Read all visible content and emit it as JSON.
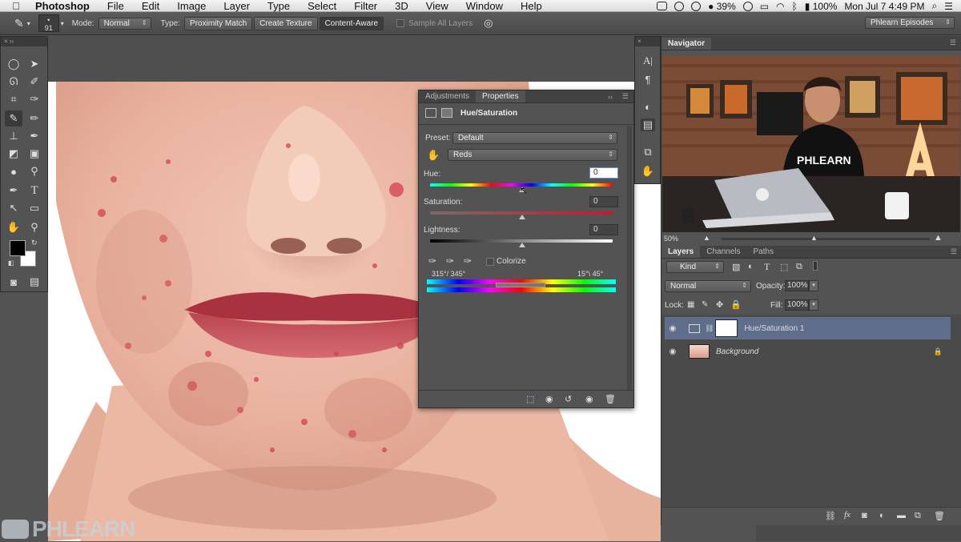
{
  "menubar": {
    "app": "Photoshop",
    "items": [
      "File",
      "Edit",
      "Image",
      "Layer",
      "Type",
      "Select",
      "Filter",
      "3D",
      "View",
      "Window",
      "Help"
    ],
    "battery": "39%",
    "volume": "100%",
    "clock": "Mon Jul 7  4:49 PM"
  },
  "options": {
    "brush_size": "91",
    "mode_label": "Mode:",
    "mode_value": "Normal",
    "type_label": "Type:",
    "type_buttons": [
      "Proximity Match",
      "Create Texture",
      "Content-Aware"
    ],
    "sample_all": "Sample All Layers",
    "workspace": "Phlearn Episodes"
  },
  "properties": {
    "tabs": [
      "Adjustments",
      "Properties"
    ],
    "title": "Hue/Saturation",
    "preset_label": "Preset:",
    "preset_value": "Default",
    "channel_value": "Reds",
    "hue_label": "Hue:",
    "hue_value": "0",
    "saturation_label": "Saturation:",
    "saturation_value": "0",
    "lightness_label": "Lightness:",
    "lightness_value": "0",
    "colorize_label": "Colorize",
    "range_left": "315°/ 345°",
    "range_right": "15°\\ 45°"
  },
  "navigator": {
    "title": "Navigator",
    "zoom": "50%"
  },
  "layers_panel": {
    "tabs": [
      "Layers",
      "Channels",
      "Paths"
    ],
    "filter_value": "Kind",
    "blend_value": "Normal",
    "opacity_label": "Opacity:",
    "opacity_value": "100%",
    "lock_label": "Lock:",
    "fill_label": "Fill:",
    "fill_value": "100%",
    "layers": [
      {
        "name": "Hue/Saturation 1"
      },
      {
        "name": "Background"
      }
    ]
  },
  "watermark": "PHLEARN",
  "colors": {
    "accent": "#5f6f8b"
  }
}
